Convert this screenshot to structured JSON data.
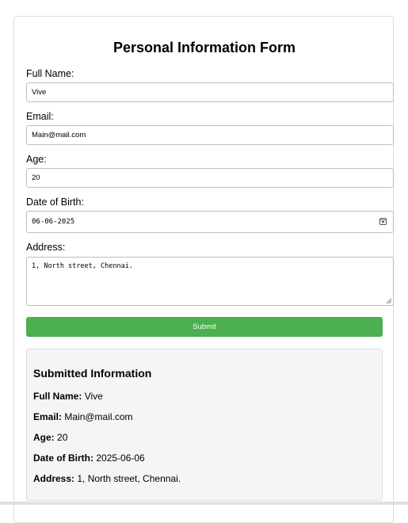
{
  "form": {
    "title": "Personal Information Form",
    "full_name": {
      "label": "Full Name:",
      "value": "Vive"
    },
    "email": {
      "label": "Email:",
      "value": "Main@mail.com"
    },
    "age": {
      "label": "Age:",
      "value": "20"
    },
    "dob": {
      "label": "Date of Birth:",
      "value": "06-06-2025",
      "icon": "calendar-icon"
    },
    "address": {
      "label": "Address:",
      "value": "1, North street, Chennai."
    },
    "submit_label": "Submit"
  },
  "colors": {
    "submit_button": "#4caf50",
    "result_background": "#f5f5f5",
    "border": "#dddddd"
  },
  "submitted": {
    "title": "Submitted Information",
    "rows": [
      {
        "label": "Full Name:",
        "value": "Vive"
      },
      {
        "label": "Email:",
        "value": "Main@mail.com"
      },
      {
        "label": "Age:",
        "value": "20"
      },
      {
        "label": "Date of Birth:",
        "value": "2025-06-06"
      },
      {
        "label": "Address:",
        "value": "1, North street, Chennai."
      }
    ]
  }
}
